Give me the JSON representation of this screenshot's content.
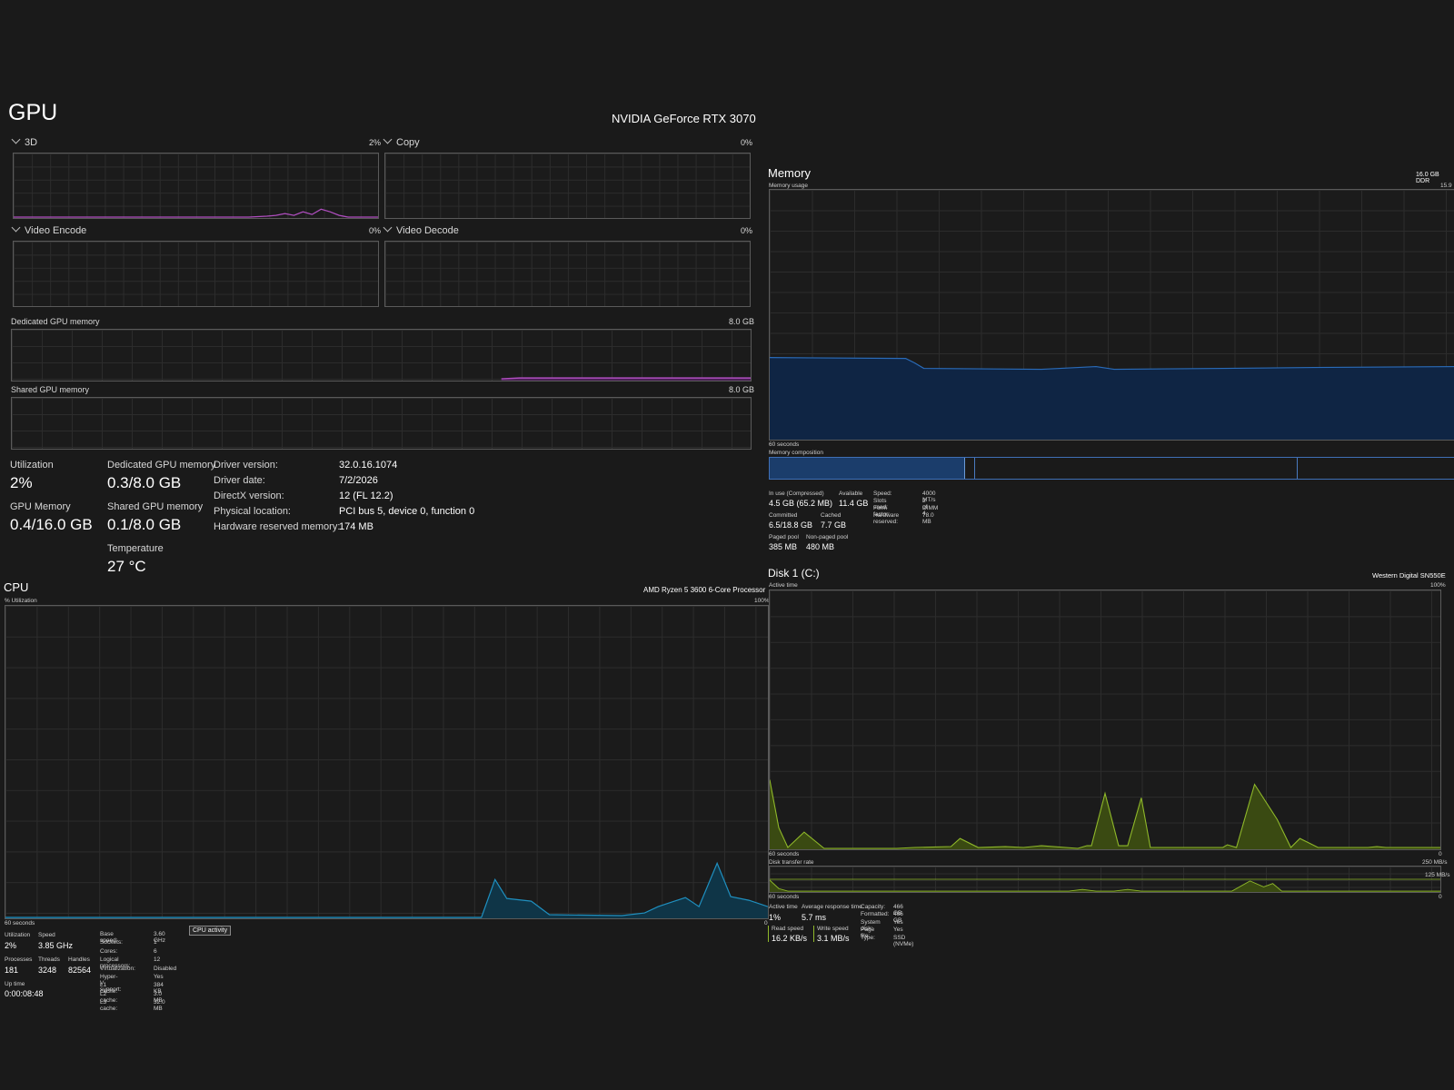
{
  "gpu": {
    "title": "GPU",
    "device": "NVIDIA GeForce RTX 3070",
    "engines": [
      {
        "label": "3D",
        "pct": "2%"
      },
      {
        "label": "Copy",
        "pct": "0%"
      },
      {
        "label": "Video Encode",
        "pct": "0%"
      },
      {
        "label": "Video Decode",
        "pct": "0%"
      }
    ],
    "dedicated_label": "Dedicated GPU memory",
    "dedicated_max": "8.0 GB",
    "shared_label": "Shared GPU memory",
    "shared_max": "8.0 GB",
    "stats": {
      "utilization_label": "Utilization",
      "utilization": "2%",
      "dedicated_label": "Dedicated GPU memory",
      "dedicated": "0.3/8.0 GB",
      "gpu_memory_label": "GPU Memory",
      "gpu_memory": "0.4/16.0 GB",
      "shared_label": "Shared GPU memory",
      "shared": "0.1/8.0 GB",
      "temperature_label": "Temperature",
      "temperature": "27 °C"
    },
    "info": [
      {
        "k": "Driver version:",
        "v": "32.0.16.1074"
      },
      {
        "k": "Driver date:",
        "v": "7/2/2026"
      },
      {
        "k": "DirectX version:",
        "v": "12 (FL 12.2)"
      },
      {
        "k": "Physical location:",
        "v": "PCI bus 5, device 0, function 0"
      },
      {
        "k": "Hardware reserved memory:",
        "v": "174 MB"
      }
    ],
    "colors": {
      "accent": "#b04ec0"
    }
  },
  "memory": {
    "title": "Memory",
    "spec": "16.0 GB DDR",
    "usage_label": "Memory usage",
    "usage_max": "15.9",
    "seconds_label": "60 seconds",
    "composition_label": "Memory composition",
    "stats": {
      "in_use_label": "In use (Compressed)",
      "in_use": "4.5 GB (65.2 MB)",
      "available_label": "Available",
      "available": "11.4 GB",
      "committed_label": "Committed",
      "committed": "6.5/18.8 GB",
      "cached_label": "Cached",
      "cached": "7.7 GB",
      "paged_label": "Paged pool",
      "paged": "385 MB",
      "nonpaged_label": "Non-paged pool",
      "nonpaged": "480 MB"
    },
    "info": [
      {
        "k": "Speed:",
        "v": "4000 MT/s"
      },
      {
        "k": "Slots used:",
        "v": "2 of 4"
      },
      {
        "k": "Form factor:",
        "v": "DIMM"
      },
      {
        "k": "Hardware reserved:",
        "v": "78.0 MB"
      }
    ],
    "colors": {
      "accent": "#2a6bb8",
      "fill": "#0f2544"
    }
  },
  "cpu": {
    "title": "CPU",
    "model": "AMD Ryzen 5 3600 6-Core Processor",
    "util_label": "% Utilization",
    "max": "100%",
    "seconds_label": "60 seconds",
    "zero": "0",
    "activity_button": "CPU activity",
    "stats": {
      "utilization_label": "Utilization",
      "utilization": "2%",
      "speed_label": "Speed",
      "speed": "3.85 GHz",
      "processes_label": "Processes",
      "processes": "181",
      "threads_label": "Threads",
      "threads": "3248",
      "handles_label": "Handles",
      "handles": "82564",
      "uptime_label": "Up time",
      "uptime": "0:00:08:48"
    },
    "info": [
      {
        "k": "Base speed:",
        "v": "3.60 GHz"
      },
      {
        "k": "Sockets:",
        "v": "1"
      },
      {
        "k": "Cores:",
        "v": "6"
      },
      {
        "k": "Logical processors:",
        "v": "12"
      },
      {
        "k": "Virtualization:",
        "v": "Disabled"
      },
      {
        "k": "Hyper-V support:",
        "v": "Yes"
      },
      {
        "k": "L1 cache:",
        "v": "384 KB"
      },
      {
        "k": "L2 cache:",
        "v": "3.0 MB"
      },
      {
        "k": "L3 cache:",
        "v": "32.0 MB"
      }
    ],
    "colors": {
      "accent": "#1f8fbf",
      "fill": "#0f3547"
    }
  },
  "disk": {
    "title": "Disk 1 (C:)",
    "model": "Western Digital SN550E",
    "active_label": "Active time",
    "max": "100%",
    "seconds_label": "60 seconds",
    "zero": "0",
    "transfer_label": "Disk transfer rate",
    "transfer_max": "250 MB/s",
    "transfer_mid": "125 MB/s",
    "stats": {
      "active_label": "Active time",
      "active": "1%",
      "response_label": "Average response time",
      "response": "5.7 ms",
      "read_label": "Read speed",
      "read": "16.2 KB/s",
      "write_label": "Write speed",
      "write": "3.1 MB/s"
    },
    "info": [
      {
        "k": "Capacity:",
        "v": "466 GB"
      },
      {
        "k": "Formatted:",
        "v": "466 GB"
      },
      {
        "k": "System disk:",
        "v": "Yes"
      },
      {
        "k": "Page file:",
        "v": "Yes"
      },
      {
        "k": "Type:",
        "v": "SSD (NVMe)"
      }
    ],
    "colors": {
      "accent": "#8fb82a",
      "fill": "#3a4a12"
    }
  }
}
